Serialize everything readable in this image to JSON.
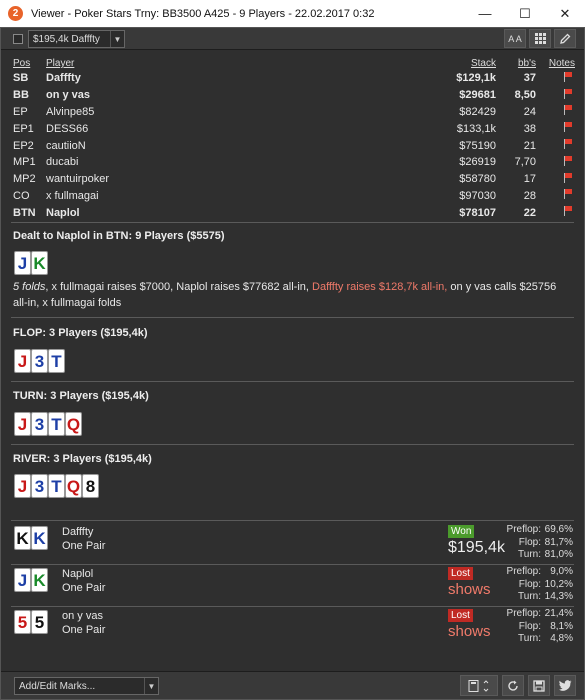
{
  "window": {
    "title": "Viewer - Poker Stars Trny: BB3500 A425 - 9 Players - 22.02.2017 0:32",
    "app_icon_glyph": "2",
    "controls": {
      "minimize": "—",
      "maximize": "☐",
      "close": "✕"
    }
  },
  "toolbar": {
    "hand_select_value": "$195,4k Dafffty",
    "font_button": "A A",
    "grid_button_icon": "grid-icon",
    "edit_button_icon": "pencil-icon"
  },
  "players_table": {
    "headers": {
      "pos": "Pos",
      "player": "Player",
      "stack": "Stack",
      "bbs": "bb's",
      "notes": "Notes"
    },
    "rows": [
      {
        "pos": "SB",
        "player": "Dafffty",
        "stack": "$129,1k",
        "bbs": "37",
        "bold": true
      },
      {
        "pos": "BB",
        "player": "on y vas",
        "stack": "$29681",
        "bbs": "8,50",
        "bold": true
      },
      {
        "pos": "EP",
        "player": "Alvinpe85",
        "stack": "$82429",
        "bbs": "24",
        "bold": false
      },
      {
        "pos": "EP1",
        "player": "DESS66",
        "stack": "$133,1k",
        "bbs": "38",
        "bold": false
      },
      {
        "pos": "EP2",
        "player": "cautiioN",
        "stack": "$75190",
        "bbs": "21",
        "bold": false
      },
      {
        "pos": "MP1",
        "player": "ducabi",
        "stack": "$26919",
        "bbs": "7,70",
        "bold": false
      },
      {
        "pos": "MP2",
        "player": "wantuirpoker",
        "stack": "$58780",
        "bbs": "17",
        "bold": false
      },
      {
        "pos": "CO",
        "player": "x fullmagai",
        "stack": "$97030",
        "bbs": "28",
        "bold": false
      },
      {
        "pos": "BTN",
        "player": "Naplol",
        "stack": "$78107",
        "bbs": "22",
        "bold": true
      }
    ]
  },
  "preflop": {
    "title": "Dealt to Naplol in BTN: 9 Players ($5575)",
    "hero_cards": [
      {
        "r": "J",
        "suit": "d"
      },
      {
        "r": "K",
        "suit": "c"
      }
    ],
    "action_italic": "5 folds",
    "action_part1": ", x fullmagai raises $7000, Naplol raises $77682 all-in, ",
    "action_highlight": "Dafffty raises $128,7k all-in,",
    "action_part2": " on y vas calls $25756 all-in, x fullmagai folds"
  },
  "flop": {
    "title": "FLOP: 3 Players ($195,4k)",
    "cards": [
      {
        "r": "J",
        "suit": "h"
      },
      {
        "r": "3",
        "suit": "d"
      },
      {
        "r": "T",
        "suit": "d"
      }
    ]
  },
  "turn": {
    "title": "TURN: 3 Players ($195,4k)",
    "cards": [
      {
        "r": "J",
        "suit": "h"
      },
      {
        "r": "3",
        "suit": "d"
      },
      {
        "r": "T",
        "suit": "d"
      },
      {
        "r": "Q",
        "suit": "h"
      }
    ]
  },
  "river": {
    "title": "RIVER: 3 Players ($195,4k)",
    "cards": [
      {
        "r": "J",
        "suit": "h"
      },
      {
        "r": "3",
        "suit": "d"
      },
      {
        "r": "T",
        "suit": "d"
      },
      {
        "r": "Q",
        "suit": "h"
      },
      {
        "r": "8",
        "suit": "s"
      }
    ]
  },
  "showdown": [
    {
      "cards": [
        {
          "r": "K",
          "suit": "s"
        },
        {
          "r": "K",
          "suit": "d"
        }
      ],
      "player": "Dafffty",
      "hand": "One Pair",
      "result": "Won",
      "result_type": "won",
      "amount": "$195,4k",
      "equity": {
        "preflop_label": "Preflop:",
        "preflop": "69,6%",
        "flop_label": "Flop:",
        "flop": "81,7%",
        "turn_label": "Turn:",
        "turn": "81,0%"
      }
    },
    {
      "cards": [
        {
          "r": "J",
          "suit": "d"
        },
        {
          "r": "K",
          "suit": "c"
        }
      ],
      "player": "Naplol",
      "hand": "One Pair",
      "result": "Lost",
      "result_type": "lost",
      "amount": "shows",
      "equity": {
        "preflop_label": "Preflop:",
        "preflop": "9,0%",
        "flop_label": "Flop:",
        "flop": "10,2%",
        "turn_label": "Turn:",
        "turn": "14,3%"
      }
    },
    {
      "cards": [
        {
          "r": "5",
          "suit": "h"
        },
        {
          "r": "5",
          "suit": "s"
        }
      ],
      "player": "on y vas",
      "hand": "One Pair",
      "result": "Lost",
      "result_type": "lost",
      "amount": "shows",
      "equity": {
        "preflop_label": "Preflop:",
        "preflop": "21,4%",
        "flop_label": "Flop:",
        "flop": "8,1%",
        "turn_label": "Turn:",
        "turn": "4,8%"
      }
    }
  ],
  "bottombar": {
    "marks_select": "Add/Edit Marks...",
    "calc_button_icon": "calculator-icon",
    "refresh_button_icon": "refresh-icon",
    "save_button_icon": "save-icon",
    "twitter_button_icon": "twitter-icon"
  }
}
